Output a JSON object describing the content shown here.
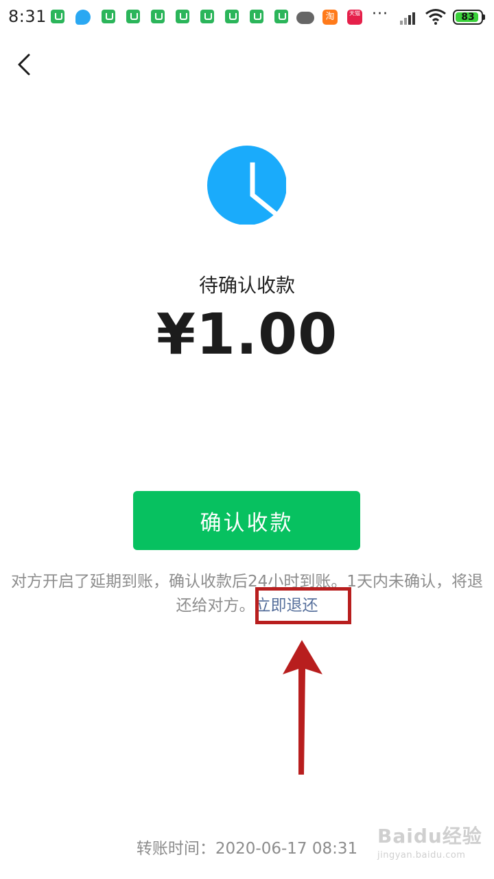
{
  "status_bar": {
    "time": "8:31",
    "battery": "83",
    "more": "···"
  },
  "notification_icons": [
    "app-notification-icon",
    "browser-icon",
    "cloud-icon",
    "taobao-icon",
    "tmall-icon"
  ],
  "taobao_label": "淘",
  "tmall_label": "天猫",
  "main": {
    "status_title": "待确认收款",
    "amount": "¥1.00",
    "confirm_button": "确认收款",
    "notice_text": "对方开启了延期到账，确认收款后24小时到账。1天内未确认，将退还给对方。",
    "return_link": "立即退还",
    "transfer_time_label": "转账时间：",
    "transfer_time_value": "2020-06-17 08:31"
  },
  "watermark": {
    "main": "Baidu经验",
    "sub": "jingyan.baidu.com"
  },
  "colors": {
    "accent_green": "#07c160",
    "clock_blue": "#1aabfb",
    "link_blue": "#57709c",
    "annotation_red": "#b81e1e"
  }
}
